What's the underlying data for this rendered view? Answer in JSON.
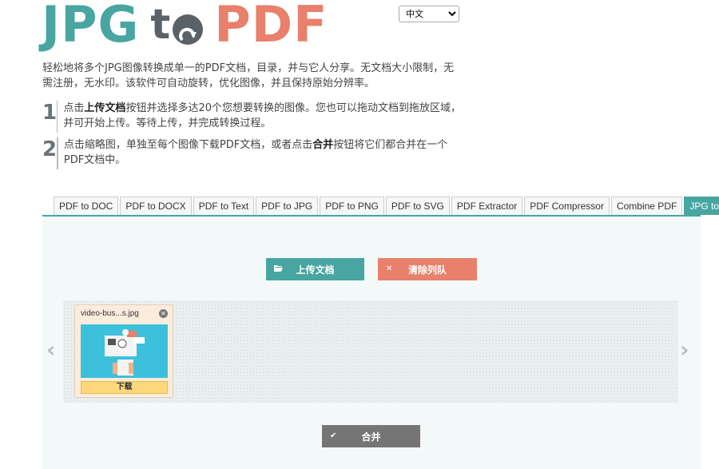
{
  "logo": {
    "part1": "JPG",
    "part2": "t",
    "part3": "PDF"
  },
  "language": {
    "selected": "中文"
  },
  "intro": "轻松地将多个JPG图像转换成单一的PDF文档，目录，并与它人分享。无文档大小限制，无需注册，无水印。该软件可自动旋转，优化图像，并且保持原始分辨率。",
  "steps": [
    {
      "num": "1",
      "pre": "点击",
      "bold1": "上传文档",
      "post": "按钮并选择多达20个您想要转换的图像。您也可以拖动文档到拖放区域，并可开始上传。等待上传，并完成转换过程。"
    },
    {
      "num": "2",
      "pre": "点击缩略图，单独至每个图像下载PDF文档，或者点击",
      "bold1": "合并",
      "post": "按钮将它们都合并在一个PDF文档中。"
    }
  ],
  "tabs": [
    {
      "label": "PDF to DOC"
    },
    {
      "label": "PDF to DOCX"
    },
    {
      "label": "PDF to Text"
    },
    {
      "label": "PDF to JPG"
    },
    {
      "label": "PDF to PNG"
    },
    {
      "label": "PDF to SVG"
    },
    {
      "label": "PDF Extractor"
    },
    {
      "label": "PDF Compressor"
    },
    {
      "label": "Combine PDF"
    },
    {
      "label": "JPG to PDF",
      "active": true
    }
  ],
  "buttons": {
    "upload": "上传文档",
    "clear": "清除列队",
    "merge": "合并"
  },
  "icons": {
    "upload": "folder-open-icon",
    "clear": "times-icon",
    "merge": "check-icon",
    "prev": "‹",
    "next": "›"
  },
  "file": {
    "name": "video-bus...s.jpg",
    "download": "下载"
  },
  "colors": {
    "teal": "#48a5a1",
    "coral": "#e8806b",
    "gray": "#5a6268",
    "merge": "#757575",
    "download": "#ffd87b"
  }
}
